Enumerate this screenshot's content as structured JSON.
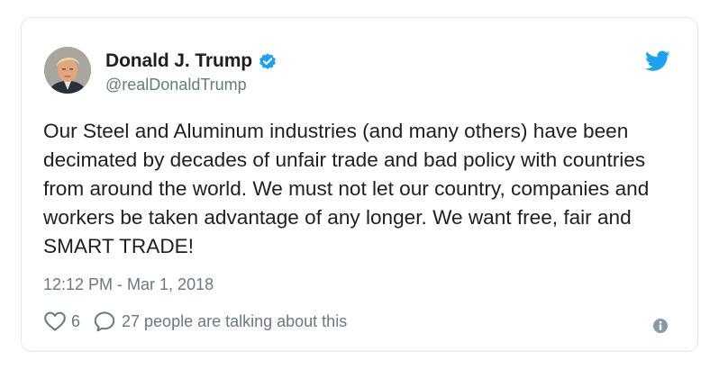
{
  "tweet": {
    "author": {
      "display_name": "Donald J. Trump",
      "handle": "@realDonaldTrump",
      "verified": true
    },
    "text": "Our Steel and Aluminum industries (and many others) have been decimated by decades of unfair trade and bad policy with countries from around the world. We must not let our country, companies and workers be taken advantage of any longer. We want free, fair and SMART TRADE!",
    "timestamp": "12:12 PM - Mar 1, 2018",
    "likes": "6",
    "talking": "27 people are talking about this"
  },
  "icons": {
    "verified": "verified-badge-icon",
    "bird": "twitter-bird-icon",
    "heart": "heart-icon",
    "reply": "speech-bubble-icon",
    "info": "info-icon"
  },
  "colors": {
    "brand": "#1da1f2",
    "text": "#1c2022",
    "muted": "#697882",
    "border": "#e1e8ed",
    "info_icon": "#8899a6"
  }
}
